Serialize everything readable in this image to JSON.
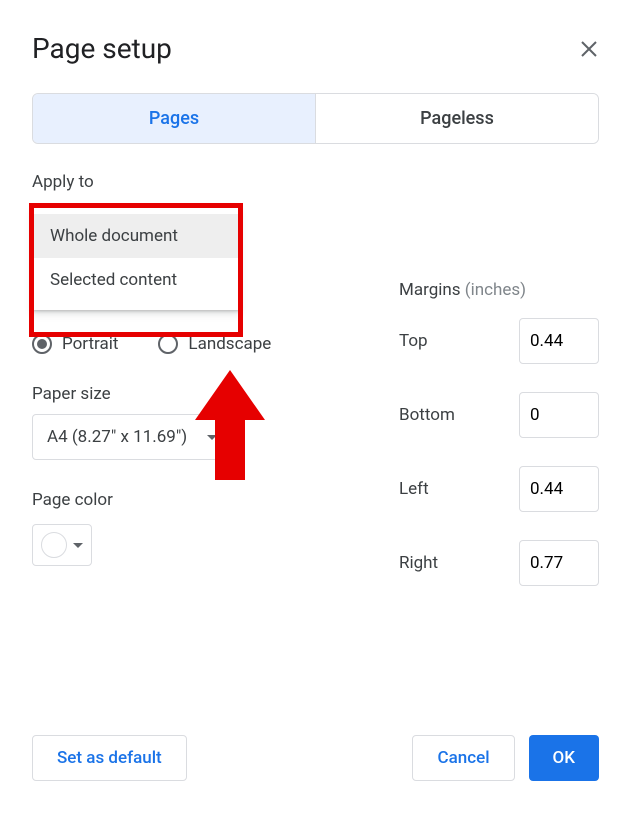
{
  "dialog": {
    "title": "Page setup"
  },
  "tabs": {
    "pages": "Pages",
    "pageless": "Pageless"
  },
  "applyTo": {
    "label": "Apply to",
    "options": {
      "whole": "Whole document",
      "selected": "Selected content"
    }
  },
  "orientation": {
    "portrait": "Portrait",
    "landscape": "Landscape"
  },
  "paperSize": {
    "label": "Paper size",
    "value": "A4 (8.27\" x 11.69\")"
  },
  "pageColor": {
    "label": "Page color"
  },
  "margins": {
    "label": "Margins",
    "unit": "(inches)",
    "top": {
      "label": "Top",
      "value": "0.44"
    },
    "bottom": {
      "label": "Bottom",
      "value": "0"
    },
    "left": {
      "label": "Left",
      "value": "0.44"
    },
    "right": {
      "label": "Right",
      "value": "0.77"
    }
  },
  "buttons": {
    "setDefault": "Set as default",
    "cancel": "Cancel",
    "ok": "OK"
  }
}
